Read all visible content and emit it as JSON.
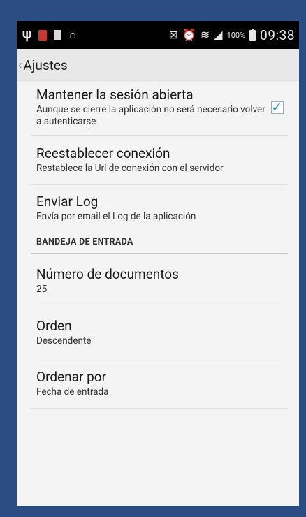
{
  "status_bar": {
    "battery_percent": "100%",
    "time": "09:38",
    "icons": [
      "usb-icon",
      "red-app-icon",
      "sd-card-icon",
      "headset-icon",
      "no-sync-icon",
      "alarm-icon",
      "wifi-icon",
      "signal-icon",
      "battery-icon"
    ]
  },
  "action_bar": {
    "back_glyph": "‹",
    "title": "Ajustes"
  },
  "preferences": {
    "keep_session": {
      "title": "Mantener la sesión abierta",
      "summary": "Aunque se cierre la aplicación no será necesario volver a autenticarse",
      "checked": true
    },
    "reset_connection": {
      "title": "Reestablecer conexión",
      "summary": "Restablece la Url de conexión con el servidor"
    },
    "send_log": {
      "title": "Enviar Log",
      "summary": "Envía por email el Log de la aplicación"
    }
  },
  "inbox_category": {
    "label": "BANDEJA DE ENTRADA",
    "items": {
      "num_docs": {
        "title": "Número de documentos",
        "value": "25"
      },
      "order": {
        "title": "Orden",
        "value": "Descendente"
      },
      "order_by": {
        "title": "Ordenar por",
        "value": "Fecha de entrada"
      }
    }
  },
  "colors": {
    "frame": "#2b4d84",
    "screen_bg": "#f4f4f4",
    "status_bar": "#000000",
    "checkbox_accent": "#2e9bd6"
  }
}
